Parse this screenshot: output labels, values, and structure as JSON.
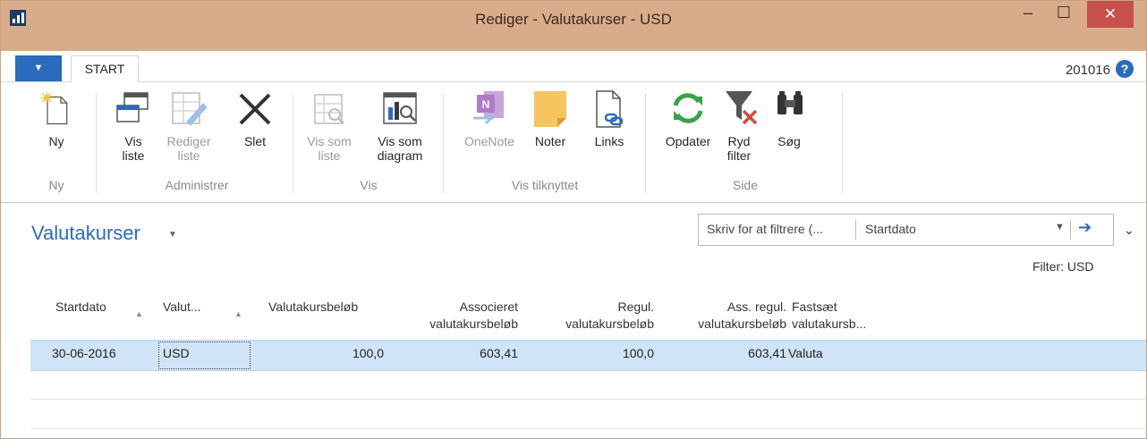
{
  "window": {
    "title": "Rediger - Valutakurser - USD",
    "min_glyph": "–",
    "max_glyph": "☐",
    "close_glyph": "✕"
  },
  "tabs": {
    "file_glyph": "▼",
    "start_label": "START",
    "company": "201016",
    "help_glyph": "?"
  },
  "ribbon": {
    "buttons": {
      "ny": {
        "label": "Ny",
        "icon": "new-document-icon"
      },
      "vis_liste": {
        "line1": "Vis",
        "line2": "liste",
        "icon": "view-list-icon"
      },
      "rediger_liste": {
        "line1": "Rediger",
        "line2": "liste",
        "icon": "edit-list-icon",
        "disabled": true
      },
      "slet": {
        "label": "Slet",
        "icon": "delete-x-icon"
      },
      "vis_som_liste": {
        "line1": "Vis som",
        "line2": "liste",
        "icon": "view-as-list-icon",
        "disabled": true
      },
      "vis_som_diagram": {
        "line1": "Vis som",
        "line2": "diagram",
        "icon": "view-as-chart-icon"
      },
      "onenote": {
        "label": "OneNote",
        "icon": "onenote-icon",
        "disabled": true
      },
      "noter": {
        "label": "Noter",
        "icon": "notes-icon"
      },
      "links": {
        "label": "Links",
        "icon": "links-icon"
      },
      "opdater": {
        "label": "Opdater",
        "icon": "refresh-icon"
      },
      "ryd_filter": {
        "line1": "Ryd",
        "line2": "filter",
        "icon": "clear-filter-icon"
      },
      "soeg": {
        "label": "Søg",
        "icon": "binoculars-icon"
      }
    },
    "groups": {
      "ny": "Ny",
      "administrer": "Administrer",
      "vis": "Vis",
      "vis_tilknyttet": "Vis tilknyttet",
      "side": "Side"
    }
  },
  "page": {
    "title": "Valutakurser",
    "title_caret": "▼",
    "search_placeholder": "Skriv for at filtrere (...",
    "search_field": "Startdato",
    "search_dropdown_glyph": "▼",
    "search_go_glyph": "➔",
    "collapse_glyph": "⌄",
    "filter_text": "Filter: USD"
  },
  "table": {
    "columns": {
      "startdato": "Startdato",
      "valuta": "Valut...",
      "valutakursbeloeb": "Valutakursbeløb",
      "assoc_1": "Associeret",
      "assoc_2": "valutakursbeløb",
      "regul_1": "Regul.",
      "regul_2": "valutakursbeløb",
      "assregul_1": "Ass. regul.",
      "assregul_2": "valutakursbeløb",
      "fastsaet_1": "Fastsæt",
      "fastsaet_2": "valutakursb..."
    },
    "sort_glyph": "▲",
    "rows": [
      {
        "startdato": "30-06-2016",
        "valuta": "USD",
        "valutakursbeloeb": "100,0",
        "associeret": "603,41",
        "regul": "100,0",
        "ass_regul": "603,41",
        "fastsaet": "Valuta"
      }
    ]
  },
  "colors": {
    "titlebar": "#d8ac8b",
    "accent": "#2b6bbd",
    "close": "#c7504b",
    "selected_row": "#cfe4f7"
  }
}
